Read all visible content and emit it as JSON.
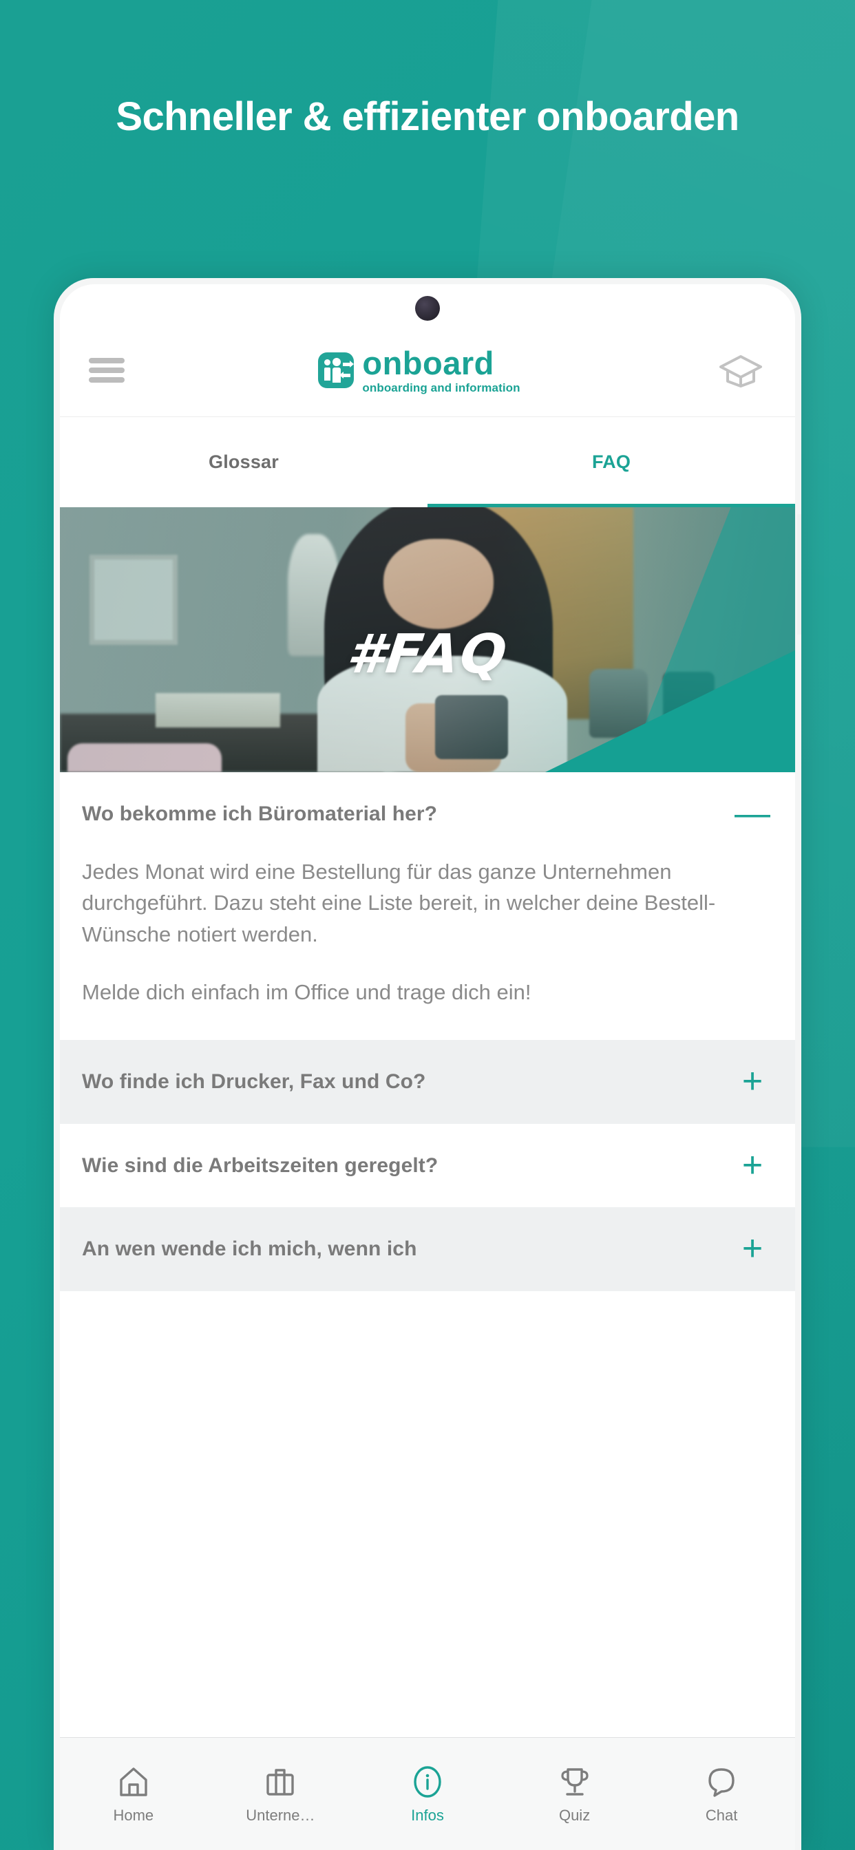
{
  "background": {
    "accent_color": "#1ba395",
    "gradient_from": "#1aa093",
    "gradient_to": "#12978c"
  },
  "promo": {
    "headline": "Schneller & effizienter onboarden"
  },
  "app": {
    "header": {
      "menu_icon": "hamburger-menu-icon",
      "logo_name": "onboard",
      "logo_tagline": "onboarding and information",
      "trailing_icon": "graduation-cap-icon"
    },
    "tabs": [
      {
        "label": "Glossar",
        "active": false
      },
      {
        "label": "FAQ",
        "active": true
      }
    ],
    "hero": {
      "overlay_text": "#FAQ",
      "image_description": "woman smiling at smartphone in living room"
    },
    "faq": [
      {
        "question": "Wo bekomme ich Büromaterial her?",
        "sign": "—",
        "expanded": true,
        "answer": [
          "Jedes Monat wird eine Bestellung für das ganze Unternehmen durchgeführt. Dazu steht eine Liste bereit, in welcher deine Bestell-Wünsche notiert werden.",
          "Melde dich einfach im Office und trage dich ein!"
        ]
      },
      {
        "question": "Wo finde ich Drucker, Fax und Co?",
        "sign": "+",
        "expanded": false,
        "answer": []
      },
      {
        "question": "Wie sind die Arbeitszeiten geregelt?",
        "sign": "+",
        "expanded": false,
        "answer": []
      },
      {
        "question": "An wen wende ich mich, wenn ich",
        "sign": "+",
        "expanded": false,
        "answer": []
      }
    ],
    "bottom_nav": [
      {
        "label": "Home",
        "icon": "home-icon",
        "active": false
      },
      {
        "label": "Unterne…",
        "icon": "briefcase-icon",
        "active": false
      },
      {
        "label": "Infos",
        "icon": "info-circle-icon",
        "active": true
      },
      {
        "label": "Quiz",
        "icon": "trophy-icon",
        "active": false
      },
      {
        "label": "Chat",
        "icon": "chat-bubble-icon",
        "active": false
      }
    ]
  }
}
